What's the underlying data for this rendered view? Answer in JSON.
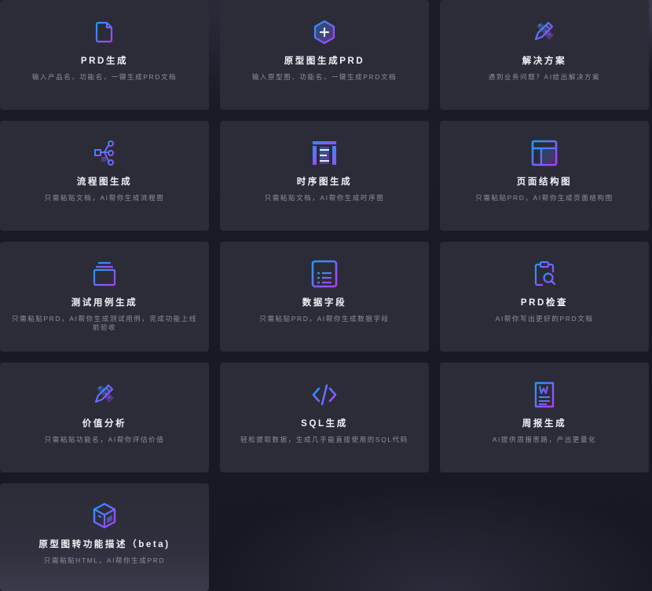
{
  "cards": [
    {
      "title": "PRD生成",
      "desc": "输入产品名、功能名，一键生成PRD文档",
      "icon": "document-icon"
    },
    {
      "title": "原型图生成PRD",
      "desc": "输入原型图、功能名，一键生成PRD文档",
      "icon": "hexagon-plus-icon"
    },
    {
      "title": "解决方案",
      "desc": "遇到业务问题？AI给出解决方案",
      "icon": "pencil-ruler-icon"
    },
    {
      "title": "流程图生成",
      "desc": "只需粘贴文档，AI帮你生成流程图",
      "icon": "flowchart-icon"
    },
    {
      "title": "时序图生成",
      "desc": "只需粘贴文档，AI帮你生成时序图",
      "icon": "sequence-chart-icon"
    },
    {
      "title": "页面结构图",
      "desc": "只需粘贴PRD，AI帮你生成页面结构图",
      "icon": "layout-icon"
    },
    {
      "title": "测试用例生成",
      "desc": "只需粘贴PRD，AI帮你生成测试用例，完成功能上线前验收",
      "icon": "stack-icon"
    },
    {
      "title": "数据字段",
      "desc": "只需粘贴PRD，AI帮你生成数据字段",
      "icon": "data-table-icon"
    },
    {
      "title": "PRD检查",
      "desc": "AI帮你写出更好的PRD文档",
      "icon": "clipboard-search-icon"
    },
    {
      "title": "价值分析",
      "desc": "只需粘贴功能名，AI帮你评估价值",
      "icon": "pencil-ruler-icon"
    },
    {
      "title": "SQL生成",
      "desc": "轻松提取数据，生成几乎能直接使用的SQL代码",
      "icon": "code-icon"
    },
    {
      "title": "周报生成",
      "desc": "AI提供周报思路，产出更量化",
      "icon": "word-doc-icon"
    },
    {
      "title": "原型图转功能描述（beta)",
      "desc": "只需粘贴HTML，AI帮你生成PRD",
      "icon": "cube-icon"
    }
  ],
  "colors": {
    "gradient_start": "#1e9bff",
    "gradient_end": "#b23cff",
    "card_bg": "#2b2c37"
  }
}
